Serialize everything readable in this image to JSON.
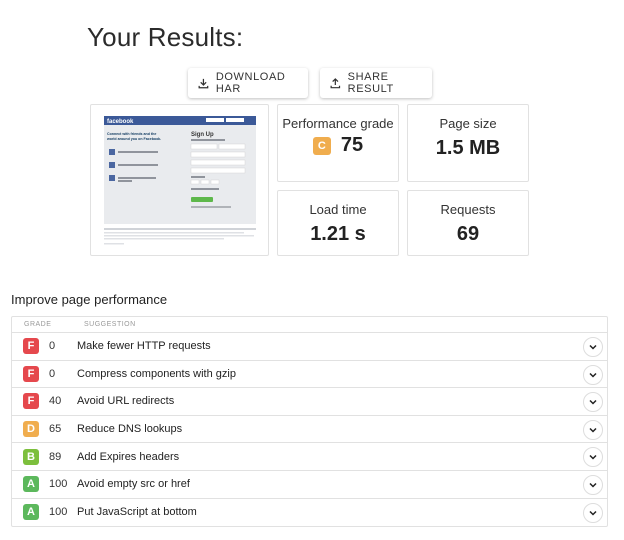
{
  "page": {
    "title": "Your Results:"
  },
  "actions": {
    "download_har": "DOWNLOAD HAR",
    "share_result": "SHARE RESULT"
  },
  "screenshot": {
    "brand": "facebook",
    "headline": "Connect with friends and the world around you on Facebook.",
    "signup_title": "Sign Up",
    "signup_sub": "It's free and always will be.",
    "signup_button": "Sign Up"
  },
  "metrics": {
    "performance": {
      "label": "Performance grade",
      "grade": "C",
      "value": "75"
    },
    "page_size": {
      "label": "Page size",
      "value": "1.5 MB"
    },
    "load_time": {
      "label": "Load time",
      "value": "1.21 s"
    },
    "requests": {
      "label": "Requests",
      "value": "69"
    }
  },
  "improve": {
    "title": "Improve page performance",
    "columns": {
      "grade": "GRADE",
      "suggestion": "SUGGESTION"
    },
    "rows": [
      {
        "grade": "F",
        "score": "0",
        "suggestion": "Make fewer HTTP requests"
      },
      {
        "grade": "F",
        "score": "0",
        "suggestion": "Compress components with gzip"
      },
      {
        "grade": "F",
        "score": "40",
        "suggestion": "Avoid URL redirects"
      },
      {
        "grade": "D",
        "score": "65",
        "suggestion": "Reduce DNS lookups"
      },
      {
        "grade": "B",
        "score": "89",
        "suggestion": "Add Expires headers"
      },
      {
        "grade": "A",
        "score": "100",
        "suggestion": "Avoid empty src or href"
      },
      {
        "grade": "A",
        "score": "100",
        "suggestion": "Put JavaScript at bottom"
      }
    ]
  },
  "grade_colors": {
    "A": "#5cb85c",
    "B": "#7cbf3c",
    "C": "#f0ad4e",
    "D": "#f0ad4e",
    "F": "#e5484d"
  }
}
